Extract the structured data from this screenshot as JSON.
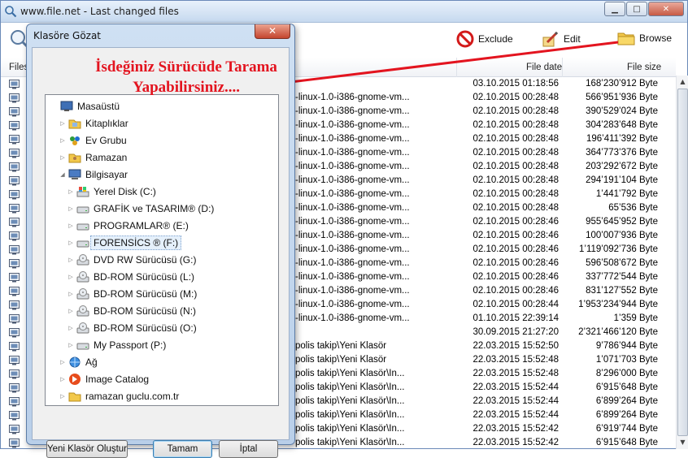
{
  "window": {
    "title": "www.file.net - Last changed files"
  },
  "toolbar": {
    "exclude_label": "Exclude",
    "edit_label": "Edit",
    "browse_label": "Browse"
  },
  "grid": {
    "headers": {
      "files": "Files",
      "date": "File date",
      "size": "File size"
    },
    "rows": [
      {
        "name": "",
        "date": "03.10.2015 01:18:56",
        "size": "168’230’912 Byte"
      },
      {
        "name": "-linux-1.0-i386-gnome-vm...",
        "date": "02.10.2015 00:28:48",
        "size": "566’951’936 Byte"
      },
      {
        "name": "-linux-1.0-i386-gnome-vm...",
        "date": "02.10.2015 00:28:48",
        "size": "390’529’024 Byte"
      },
      {
        "name": "-linux-1.0-i386-gnome-vm...",
        "date": "02.10.2015 00:28:48",
        "size": "304’283’648 Byte"
      },
      {
        "name": "-linux-1.0-i386-gnome-vm...",
        "date": "02.10.2015 00:28:48",
        "size": "196’411’392 Byte"
      },
      {
        "name": "-linux-1.0-i386-gnome-vm...",
        "date": "02.10.2015 00:28:48",
        "size": "364’773’376 Byte"
      },
      {
        "name": "-linux-1.0-i386-gnome-vm...",
        "date": "02.10.2015 00:28:48",
        "size": "203’292’672 Byte"
      },
      {
        "name": "-linux-1.0-i386-gnome-vm...",
        "date": "02.10.2015 00:28:48",
        "size": "294’191’104 Byte"
      },
      {
        "name": "-linux-1.0-i386-gnome-vm...",
        "date": "02.10.2015 00:28:48",
        "size": "1’441’792 Byte"
      },
      {
        "name": "-linux-1.0-i386-gnome-vm...",
        "date": "02.10.2015 00:28:48",
        "size": "65’536 Byte"
      },
      {
        "name": "-linux-1.0-i386-gnome-vm...",
        "date": "02.10.2015 00:28:46",
        "size": "955’645’952 Byte"
      },
      {
        "name": "-linux-1.0-i386-gnome-vm...",
        "date": "02.10.2015 00:28:46",
        "size": "100’007’936 Byte"
      },
      {
        "name": "-linux-1.0-i386-gnome-vm...",
        "date": "02.10.2015 00:28:46",
        "size": "1’119’092’736 Byte"
      },
      {
        "name": "-linux-1.0-i386-gnome-vm...",
        "date": "02.10.2015 00:28:46",
        "size": "596’508’672 Byte"
      },
      {
        "name": "-linux-1.0-i386-gnome-vm...",
        "date": "02.10.2015 00:28:46",
        "size": "337’772’544 Byte"
      },
      {
        "name": "-linux-1.0-i386-gnome-vm...",
        "date": "02.10.2015 00:28:46",
        "size": "831’127’552 Byte"
      },
      {
        "name": "-linux-1.0-i386-gnome-vm...",
        "date": "02.10.2015 00:28:44",
        "size": "1’953’234’944 Byte"
      },
      {
        "name": "-linux-1.0-i386-gnome-vm...",
        "date": "01.10.2015 22:39:14",
        "size": "1’359 Byte"
      },
      {
        "name": "",
        "date": "30.09.2015 21:27:20",
        "size": "2’321’466’120 Byte"
      },
      {
        "name": "polis takip\\Yeni Klasör",
        "date": "22.03.2015 15:52:50",
        "size": "9’786’944 Byte"
      },
      {
        "name": "polis takip\\Yeni Klasör",
        "date": "22.03.2015 15:52:48",
        "size": "1’071’703 Byte"
      },
      {
        "name": "polis takip\\Yeni Klasör\\In...",
        "date": "22.03.2015 15:52:48",
        "size": "8’296’000 Byte"
      },
      {
        "name": "polis takip\\Yeni Klasör\\In...",
        "date": "22.03.2015 15:52:44",
        "size": "6’915’648 Byte"
      },
      {
        "name": "polis takip\\Yeni Klasör\\In...",
        "date": "22.03.2015 15:52:44",
        "size": "6’899’264 Byte"
      },
      {
        "name": "polis takip\\Yeni Klasör\\In...",
        "date": "22.03.2015 15:52:44",
        "size": "6’899’264 Byte"
      },
      {
        "name": "polis takip\\Yeni Klasör\\In...",
        "date": "22.03.2015 15:52:42",
        "size": "6’919’744 Byte"
      },
      {
        "name": "polis takip\\Yeni Klasör\\In...",
        "date": "22.03.2015 15:52:42",
        "size": "6’915’648 Byte"
      }
    ]
  },
  "annotation": {
    "line1": "İsdeğiniz Sürücüde Tarama",
    "line2": "Yapabilirsiniz...."
  },
  "dialog": {
    "title": "Klasöre Gözat",
    "close_label": "✕",
    "tree": [
      {
        "label": "Masaüstü",
        "icon": "desktop-icon",
        "level": 0,
        "expander": ""
      },
      {
        "label": "Kitaplıklar",
        "icon": "library-icon",
        "level": 1,
        "expander": "▷"
      },
      {
        "label": "Ev Grubu",
        "icon": "homegroup-icon",
        "level": 1,
        "expander": "▷"
      },
      {
        "label": "Ramazan",
        "icon": "user-folder-icon",
        "level": 1,
        "expander": "▷"
      },
      {
        "label": "Bilgisayar",
        "icon": "computer-icon",
        "level": 1,
        "expander": "◢"
      },
      {
        "label": "Yerel Disk (C:)",
        "icon": "windows-drive-icon",
        "level": 2,
        "expander": "▷"
      },
      {
        "label": "GRAFİK ve TASARIM® (D:)",
        "icon": "drive-icon",
        "level": 2,
        "expander": "▷"
      },
      {
        "label": "PROGRAMLAR® (E:)",
        "icon": "drive-icon",
        "level": 2,
        "expander": "▷"
      },
      {
        "label": "FORENSİCS ® (F:)",
        "icon": "drive-icon",
        "level": 2,
        "expander": "▷",
        "selected": true
      },
      {
        "label": "DVD RW Sürücüsü (G:)",
        "icon": "optical-drive-icon",
        "level": 2,
        "expander": "▷"
      },
      {
        "label": "BD-ROM Sürücüsü (L:)",
        "icon": "optical-drive-icon",
        "level": 2,
        "expander": "▷"
      },
      {
        "label": "BD-ROM Sürücüsü (M:)",
        "icon": "optical-drive-icon",
        "level": 2,
        "expander": "▷"
      },
      {
        "label": "BD-ROM Sürücüsü (N:)",
        "icon": "optical-drive-icon",
        "level": 2,
        "expander": "▷"
      },
      {
        "label": "BD-ROM Sürücüsü (O:)",
        "icon": "optical-drive-icon",
        "level": 2,
        "expander": "▷"
      },
      {
        "label": "My Passport (P:)",
        "icon": "drive-icon",
        "level": 2,
        "expander": "▷"
      },
      {
        "label": "Ağ",
        "icon": "network-icon",
        "level": 1,
        "expander": "▷"
      },
      {
        "label": "Image Catalog",
        "icon": "image-catalog-icon",
        "level": 1,
        "expander": "▷"
      },
      {
        "label": "ramazan guclu.com.tr",
        "icon": "folder-icon",
        "level": 1,
        "expander": "▷"
      }
    ],
    "buttons": {
      "new_folder": "Yeni Klasör Oluştur",
      "ok": "Tamam",
      "cancel": "İptal"
    }
  },
  "colors": {
    "annotation": "#e3141f",
    "accent": "#3c7fb1"
  }
}
